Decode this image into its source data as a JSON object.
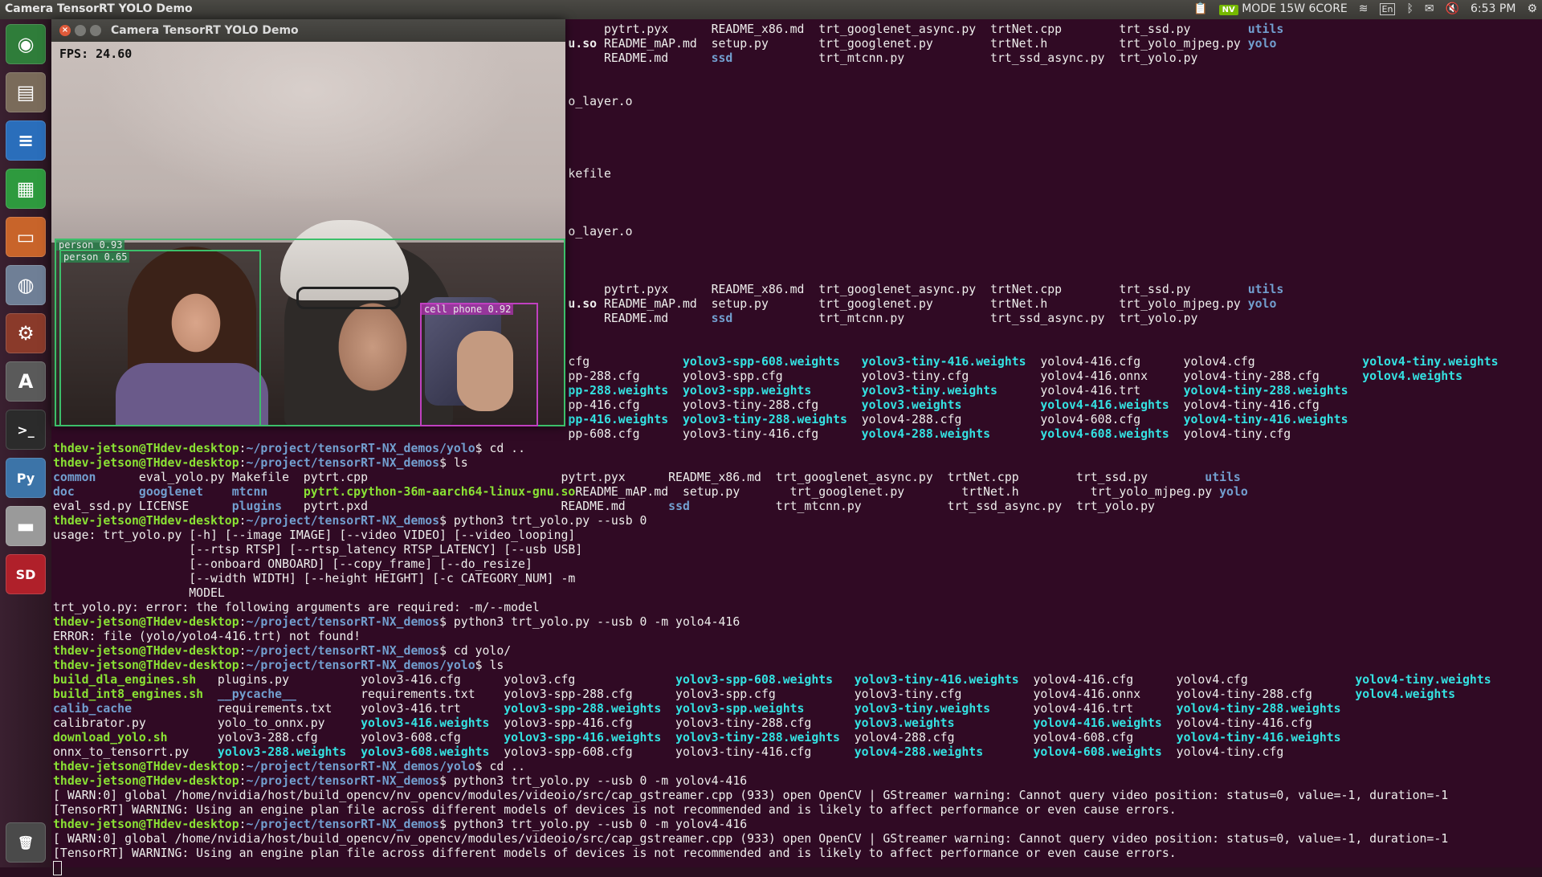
{
  "panel": {
    "window_title": "Camera TensorRT YOLO Demo",
    "nvpmodel": "MODE 15W 6CORE",
    "keyboard": "En",
    "clock": "6:53 PM"
  },
  "launcher": {
    "items": [
      {
        "name": "ubuntu-dash-icon",
        "glyph": "◉",
        "bg": "#2f7d3a"
      },
      {
        "name": "files-icon",
        "glyph": "▤",
        "bg": "#7a6b5a"
      },
      {
        "name": "writer-icon",
        "glyph": "≡",
        "bg": "#2a6ebb"
      },
      {
        "name": "calc-icon",
        "glyph": "▦",
        "bg": "#2e9a3e"
      },
      {
        "name": "impress-icon",
        "glyph": "▭",
        "bg": "#c8642a"
      },
      {
        "name": "software-center-icon",
        "glyph": "◍",
        "bg": "#6f7f96"
      },
      {
        "name": "system-settings-icon",
        "glyph": "⚙",
        "bg": "#8a3a2a"
      },
      {
        "name": "software-updater-icon",
        "glyph": "A",
        "bg": "#5a5a5a"
      },
      {
        "name": "terminal-icon",
        "glyph": ">_",
        "bg": "#2b2b2b"
      },
      {
        "name": "python-icon",
        "glyph": "Py",
        "bg": "#3c74a8"
      },
      {
        "name": "drive-icon",
        "glyph": "▬",
        "bg": "#9a9a9a"
      },
      {
        "name": "sd-card-icon",
        "glyph": "SD",
        "bg": "#b0202a"
      },
      {
        "name": "trash-icon",
        "glyph": "🗑",
        "bg": "#4a4a4a"
      }
    ]
  },
  "camera": {
    "title": "Camera TensorRT YOLO Demo",
    "fps": "FPS: 24.60",
    "detections": [
      {
        "label": "person 0.93",
        "color": "#3cbf6a"
      },
      {
        "label": "person 0.65",
        "color": "#3cbf6a"
      },
      {
        "label": "cell phone 0.92",
        "color": "#c040c0"
      }
    ]
  },
  "terminal": {
    "prompt": "thdev-jetson@THdev-desktop",
    "path_demos": "~/project/tensorRT-NX_demos",
    "path_yolo": "~/project/tensorRT-NX_demos/yolo",
    "frag_so": "u.so",
    "frag_layer": "o_layer.o",
    "frag_makefile": "kefile",
    "ls1": [
      {
        "a": "common",
        "b": "eval_yolo.py",
        "c": "Makefile",
        "d": "pytrt.cpp",
        "e": "pytrt.pyx",
        "f": "README_x86.md",
        "g": "trt_googlenet_async.py",
        "h": "trtNet.cpp",
        "i": "trt_ssd.py",
        "j": "utils"
      },
      {
        "a": "doc",
        "b": "googlenet",
        "c": "mtcnn",
        "d": "pytrt.cpython-36m-aarch64-linux-gnu.so",
        "e": "README_mAP.md",
        "f": "setup.py",
        "g": "trt_googlenet.py",
        "h": "trtNet.h",
        "i": "trt_yolo_mjpeg.py",
        "j": "yolo"
      },
      {
        "a": "eval_ssd.py",
        "b": "LICENSE",
        "c": "plugins",
        "d": "pytrt.pxd",
        "e": "README.md",
        "f": "ssd",
        "g": "trt_mtcnn.py",
        "h": "trt_ssd_async.py",
        "i": "trt_yolo.py",
        "j": ""
      }
    ],
    "cmd_cd_up": "cd ..",
    "cmd_ls": "ls",
    "cmd_run_usb": "python3 trt_yolo.py --usb 0",
    "usage": [
      "usage: trt_yolo.py [-h] [--image IMAGE] [--video VIDEO] [--video_looping]",
      "                   [--rtsp RTSP] [--rtsp_latency RTSP_LATENCY] [--usb USB]",
      "                   [--onboard ONBOARD] [--copy_frame] [--do_resize]",
      "                   [--width WIDTH] [--height HEIGHT] [-c CATEGORY_NUM] -m",
      "                   MODEL",
      "trt_yolo.py: error: the following arguments are required: -m/--model"
    ],
    "cmd_run_yolo4": "python3 trt_yolo.py --usb 0 -m yolo4-416",
    "err_notfound": "ERROR: file (yolo/yolo4-416.trt) not found!",
    "cmd_cd_yolo": "cd yolo/",
    "ls2": [
      [
        "build_dla_engines.sh",
        "plugins.py",
        "yolov3-416.cfg",
        "yolov3.cfg",
        "yolov3-spp-608.weights",
        "yolov3-tiny-416.weights",
        "yolov4-416.cfg",
        "yolov4.cfg",
        "yolov4-tiny.weights"
      ],
      [
        "build_int8_engines.sh",
        "__pycache__",
        "requirements.txt",
        "yolov3-spp-288.cfg",
        "yolov3-spp.cfg",
        "yolov3-tiny.cfg",
        "yolov4-416.onnx",
        "yolov4-tiny-288.cfg",
        "yolov4.weights"
      ],
      [
        "calib_cache",
        "requirements.txt",
        "yolov3-416.trt",
        "yolov3-spp-288.weights",
        "yolov3-spp.weights",
        "yolov3-tiny.weights",
        "yolov4-416.trt",
        "yolov4-tiny-288.weights",
        ""
      ],
      [
        "calibrator.py",
        "yolo_to_onnx.py",
        "yolov3-416.weights",
        "yolov3-spp-416.cfg",
        "yolov3-tiny-288.cfg",
        "yolov3.weights",
        "yolov4-416.weights",
        "yolov4-tiny-416.cfg",
        ""
      ],
      [
        "download_yolo.sh",
        "yolov3-288.cfg",
        "yolov3-608.cfg",
        "yolov3-spp-416.weights",
        "yolov3-tiny-288.weights",
        "yolov4-288.cfg",
        "yolov4-608.cfg",
        "yolov4-tiny-416.weights",
        ""
      ],
      [
        "onnx_to_tensorrt.py",
        "yolov3-288.weights",
        "yolov3-608.weights",
        "yolov3-spp-608.cfg",
        "yolov3-tiny-416.cfg",
        "yolov4-288.weights",
        "yolov4-608.weights",
        "yolov4-tiny.cfg",
        ""
      ]
    ],
    "ls2_upper_col1": [
      "cfg",
      "pp-288.cfg",
      "pp-288.weights",
      "pp-416.cfg",
      "pp-416.weights",
      "pp-608.cfg"
    ],
    "cmd_run_yolov4": "python3 trt_yolo.py --usb 0 -m yolov4-416",
    "warn_gst": "[ WARN:0] global /home/nvidia/host/build_opencv/nv_opencv/modules/videoio/src/cap_gstreamer.cpp (933) open OpenCV | GStreamer warning: Cannot query video position: status=0, value=-1, duration=-1",
    "warn_trt": "[TensorRT] WARNING: Using an engine plan file across different models of devices is not recommended and is likely to affect performance or even cause errors."
  }
}
